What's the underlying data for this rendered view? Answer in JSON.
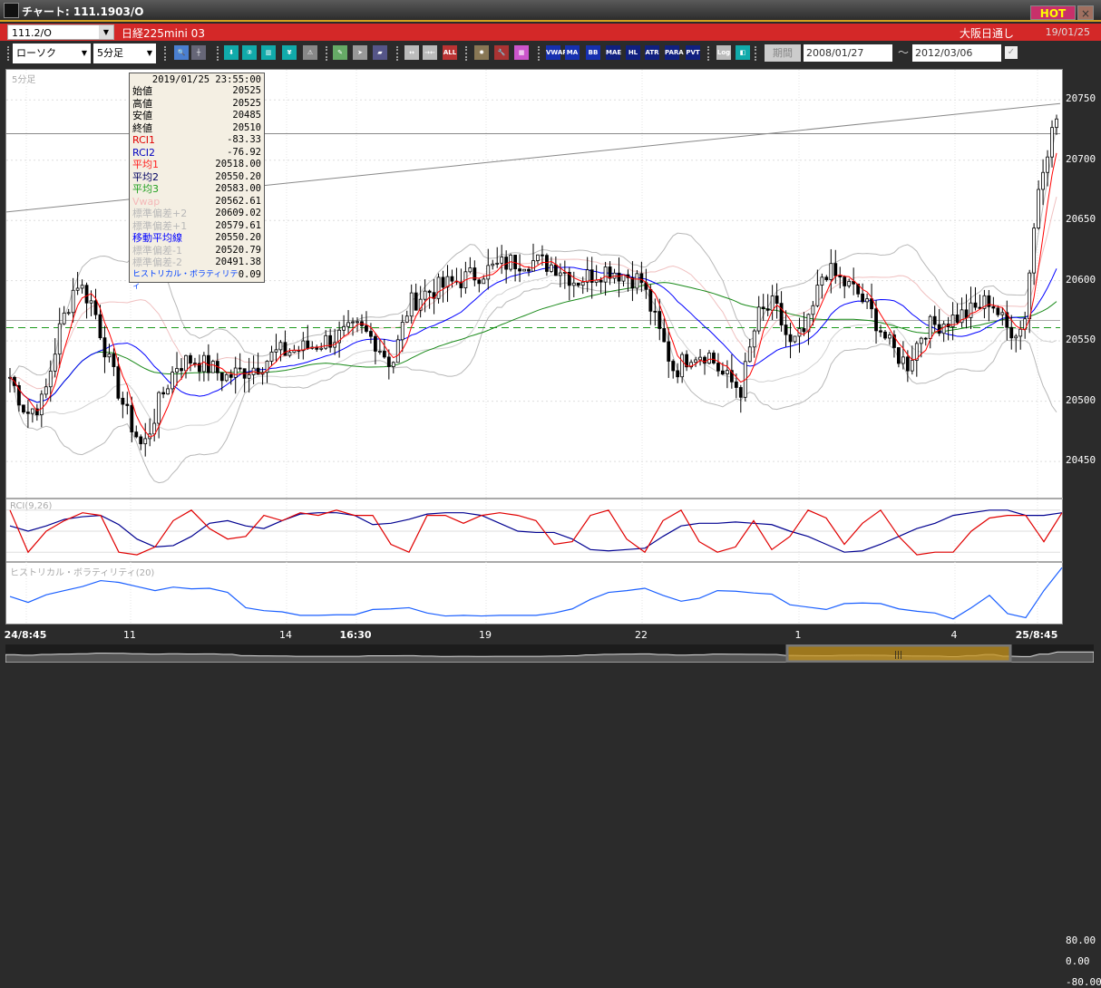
{
  "window": {
    "title": "チャート: 111.1903/O",
    "hot": "HOT",
    "close": "×"
  },
  "symbolbar": {
    "symbol": "111.2/O",
    "name": "日経225mini 03",
    "market": "大阪日通し",
    "date": "19/01/25"
  },
  "toolbar": {
    "chart_type": "ローソク",
    "interval": "5分足",
    "period_label": "期間",
    "date_from": "2008/01/27",
    "date_to": "2012/03/06",
    "tilde": "〜",
    "buttons": [
      {
        "name": "zoom-icon",
        "label": "🔍",
        "bg": "#4a7fd0"
      },
      {
        "name": "crosshair-icon",
        "label": "┼",
        "bg": "#667"
      },
      {
        "name": "download-icon",
        "label": "⬇",
        "bg": "#1aa"
      },
      {
        "name": "search-chart-icon",
        "label": "②",
        "bg": "#1aa"
      },
      {
        "name": "bar-chart-icon",
        "label": "▥",
        "bg": "#1aa"
      },
      {
        "name": "yen-icon",
        "label": "¥",
        "bg": "#1aa"
      },
      {
        "name": "alert-icon",
        "label": "⚠",
        "bg": "#888"
      },
      {
        "name": "pencil-icon",
        "label": "✎",
        "bg": "#6a6"
      },
      {
        "name": "pointer-icon",
        "label": "➤",
        "bg": "#999"
      },
      {
        "name": "eraser-icon",
        "label": "▰",
        "bg": "#558"
      },
      {
        "name": "expand-icon",
        "label": "↔",
        "bg": "#bbb"
      },
      {
        "name": "shrink-icon",
        "label": "→←",
        "bg": "#bbb"
      },
      {
        "name": "all-icon",
        "label": "ALL",
        "bg": "#b33"
      },
      {
        "name": "settings-icon",
        "label": "✹",
        "bg": "#875"
      },
      {
        "name": "wrench-icon",
        "label": "🔧",
        "bg": "#a33"
      },
      {
        "name": "color-icon",
        "label": "▦",
        "bg": "#c5c"
      },
      {
        "name": "vwap-icon",
        "label": "VWAP",
        "bg": "#1630b0"
      },
      {
        "name": "ma-icon",
        "label": "MA",
        "bg": "#1630b0"
      },
      {
        "name": "bb-icon",
        "label": "BB",
        "bg": "#1630b0"
      },
      {
        "name": "mae-icon",
        "label": "MAE",
        "bg": "#102080"
      },
      {
        "name": "hl-icon",
        "label": "HL",
        "bg": "#102080"
      },
      {
        "name": "atr-icon",
        "label": "ATR",
        "bg": "#102080"
      },
      {
        "name": "para-icon",
        "label": "PARA",
        "bg": "#102080"
      },
      {
        "name": "pvt-icon",
        "label": "PVT",
        "bg": "#102080"
      },
      {
        "name": "log-icon",
        "label": "Log",
        "bg": "#bbb"
      },
      {
        "name": "split-icon",
        "label": "◧",
        "bg": "#1aa"
      }
    ]
  },
  "tooltip": {
    "datetime": "2019/01/25  23:55:00",
    "rows": [
      {
        "label": "始値",
        "value": "20525",
        "color": "#000"
      },
      {
        "label": "高値",
        "value": "20525",
        "color": "#000"
      },
      {
        "label": "安値",
        "value": "20485",
        "color": "#000"
      },
      {
        "label": "終値",
        "value": "20510",
        "color": "#000"
      },
      {
        "label": "RCI1",
        "value": "-83.33",
        "color": "#e00000"
      },
      {
        "label": "RCI2",
        "value": "-76.92",
        "color": "#0000c0"
      },
      {
        "label": "平均1",
        "value": "20518.00",
        "color": "#ff2020"
      },
      {
        "label": "平均2",
        "value": "20550.20",
        "color": "#000060"
      },
      {
        "label": "平均3",
        "value": "20583.00",
        "color": "#20a020"
      },
      {
        "label": "Vwap",
        "value": "20562.61",
        "color": "#f4b8b8"
      },
      {
        "label": "標準偏差+2",
        "value": "20609.02",
        "color": "#b8b8b8"
      },
      {
        "label": "標準偏差+1",
        "value": "20579.61",
        "color": "#b8b8b8"
      },
      {
        "label": "移動平均線",
        "value": "20550.20",
        "color": "#0000ff"
      },
      {
        "label": "標準偏差-1",
        "value": "20520.79",
        "color": "#b8b8b8"
      },
      {
        "label": "標準偏差-2",
        "value": "20491.38",
        "color": "#b8b8b8"
      },
      {
        "label": "ヒストリカル・ボラティリティ",
        "value": "0.09",
        "color": "#0040ff"
      }
    ]
  },
  "panels": {
    "main_label": "5分足",
    "rci_label": "RCI(9,26)",
    "hv_label": "ヒストリカル・ボラティリティ(20)"
  },
  "chart_data": {
    "type": "candlestick",
    "price_ticks": [
      "20750",
      "20700",
      "20650",
      "20600",
      "20550",
      "20500",
      "20450"
    ],
    "price_ylim": [
      20420,
      20775
    ],
    "rci_ticks": [
      "80.00",
      "0.00",
      "-80.00"
    ],
    "time_labels": [
      {
        "t": "24/8:45",
        "bold": true
      },
      {
        "t": "11"
      },
      {
        "t": "14"
      },
      {
        "t": "16:30",
        "bold": true
      },
      {
        "t": "19"
      },
      {
        "t": "22"
      },
      {
        "t": "1"
      },
      {
        "t": "4"
      },
      {
        "t": "25/8:45",
        "bold": true
      }
    ],
    "close_anchors": [
      20520,
      20490,
      20500,
      20560,
      20600,
      20580,
      20530,
      20490,
      20460,
      20500,
      20530,
      20535,
      20528,
      20520,
      20525,
      20530,
      20540,
      20542,
      20545,
      20550,
      20555,
      20560,
      20550,
      20530,
      20580,
      20590,
      20595,
      20600,
      20605,
      20610,
      20615,
      20617,
      20615,
      20612,
      20600,
      20605,
      20610,
      20605,
      20600,
      20560,
      20525,
      20540,
      20540,
      20520,
      20510,
      20570,
      20580,
      20545,
      20560,
      20610,
      20600,
      20590,
      20570,
      20545,
      20530,
      20560,
      20565,
      20570,
      20575,
      20585,
      20560,
      20560,
      20690,
      20735
    ],
    "reference_lines": {
      "horizontal": 20722,
      "dashed_green": 20561,
      "gray": 20567,
      "trend_start": 20657,
      "trend_end": 20747
    },
    "rci_short": [
      80,
      -80,
      0,
      40,
      70,
      60,
      -80,
      -90,
      -60,
      40,
      80,
      10,
      -30,
      -20,
      60,
      40,
      70,
      60,
      80,
      60,
      60,
      -50,
      -80,
      60,
      60,
      30,
      60,
      70,
      60,
      40,
      -50,
      -40,
      60,
      80,
      -30,
      -80,
      40,
      80,
      -40,
      -80,
      -60,
      40,
      -70,
      -20,
      80,
      50,
      -50,
      30,
      80,
      -20,
      -90,
      -80,
      -80,
      0,
      50,
      60,
      60,
      -40,
      70
    ],
    "rci_long": [
      20,
      0,
      20,
      45,
      55,
      60,
      25,
      -30,
      -60,
      -55,
      -20,
      30,
      40,
      20,
      10,
      40,
      65,
      70,
      70,
      60,
      25,
      30,
      45,
      65,
      70,
      70,
      60,
      30,
      0,
      -5,
      -5,
      -30,
      -70,
      -75,
      -70,
      -65,
      -20,
      20,
      30,
      30,
      35,
      30,
      25,
      0,
      -20,
      -50,
      -80,
      -75,
      -50,
      -20,
      10,
      30,
      60,
      70,
      80,
      80,
      60,
      60,
      70
    ],
    "hv": [
      0.046,
      0.036,
      0.049,
      0.056,
      0.063,
      0.073,
      0.07,
      0.063,
      0.056,
      0.062,
      0.059,
      0.06,
      0.053,
      0.027,
      0.022,
      0.02,
      0.014,
      0.014,
      0.015,
      0.015,
      0.024,
      0.025,
      0.027,
      0.018,
      0.013,
      0.014,
      0.013,
      0.014,
      0.014,
      0.014,
      0.018,
      0.025,
      0.041,
      0.053,
      0.056,
      0.06,
      0.048,
      0.038,
      0.043,
      0.056,
      0.055,
      0.052,
      0.05,
      0.032,
      0.028,
      0.024,
      0.034,
      0.035,
      0.034,
      0.025,
      0.021,
      0.018,
      0.008,
      0.027,
      0.048,
      0.017,
      0.01,
      0.056,
      0.095
    ],
    "hv_ylim": [
      0,
      0.1
    ]
  }
}
